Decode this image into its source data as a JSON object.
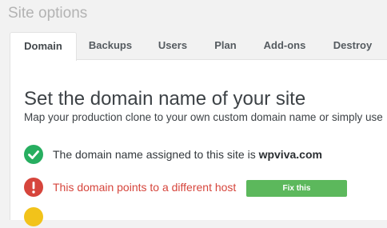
{
  "page": {
    "title": "Site options"
  },
  "tabs": [
    {
      "label": "Domain",
      "active": true
    },
    {
      "label": "Backups",
      "active": false
    },
    {
      "label": "Users",
      "active": false
    },
    {
      "label": "Plan",
      "active": false
    },
    {
      "label": "Add-ons",
      "active": false
    },
    {
      "label": "Destroy",
      "active": false
    }
  ],
  "domain_panel": {
    "heading": "Set the domain name of your site",
    "subheading": "Map your production clone to your own custom domain name or simply use",
    "status_items": [
      {
        "state": "success",
        "icon": "checkmark-icon",
        "text": "The domain name assigned to this site is ",
        "domain": "wpviva.com"
      },
      {
        "state": "error",
        "icon": "exclamation-icon",
        "text": "This domain points to a different host",
        "action_label": "Fix this"
      },
      {
        "state": "warning",
        "icon": "warning-icon"
      }
    ]
  },
  "colors": {
    "success": "#27ae60",
    "error": "#d6453c",
    "warning": "#f2c31a",
    "fix_button": "#5cb85c"
  }
}
